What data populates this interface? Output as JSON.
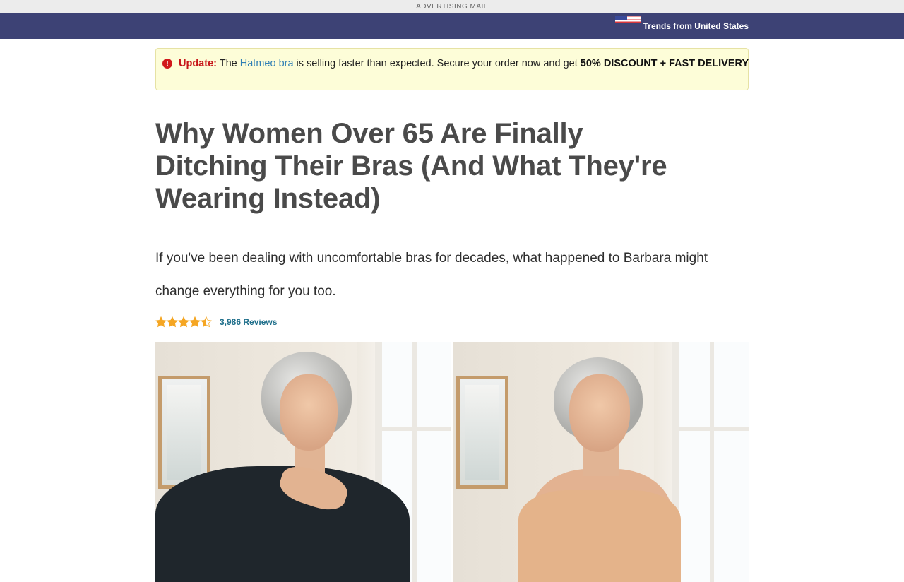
{
  "ad_bar": {
    "label": "ADVERTISING MAIL"
  },
  "top_nav": {
    "trends_label": "Trends from United States",
    "flag_icon": "us-flag-icon"
  },
  "alert": {
    "icon": "exclamation-circle-icon",
    "update_label": "Update:",
    "text_before_link": " The ",
    "link_text": "Hatmeo bra",
    "text_after_link": " is selling faster than expected. Secure your order now and get ",
    "emphasis": "50% DISCOUNT + FAST DELIVERY"
  },
  "article": {
    "headline": "Why Women Over 65 Are Finally Ditching Their Bras (And What They're Wearing Instead)",
    "subhead": "If you've been dealing with uncomfortable bras for decades, what happened to Barbara might change everything for you too.",
    "rating": {
      "stars": 4.5,
      "max_stars": 5,
      "reviews_label": "3,986 Reviews"
    },
    "images": [
      {
        "name": "before-photo",
        "description_icon": "woman-shoulder-pain-photo"
      },
      {
        "name": "after-photo",
        "description_icon": "woman-smiling-photo"
      }
    ]
  },
  "colors": {
    "nav_bg": "#3d4275",
    "alert_bg": "#fdfdd8",
    "alert_update": "#c71518",
    "link": "#2f7fb5",
    "star": "#f5a623",
    "reviews": "#1f6f8b",
    "headline": "#4a4a4a"
  }
}
